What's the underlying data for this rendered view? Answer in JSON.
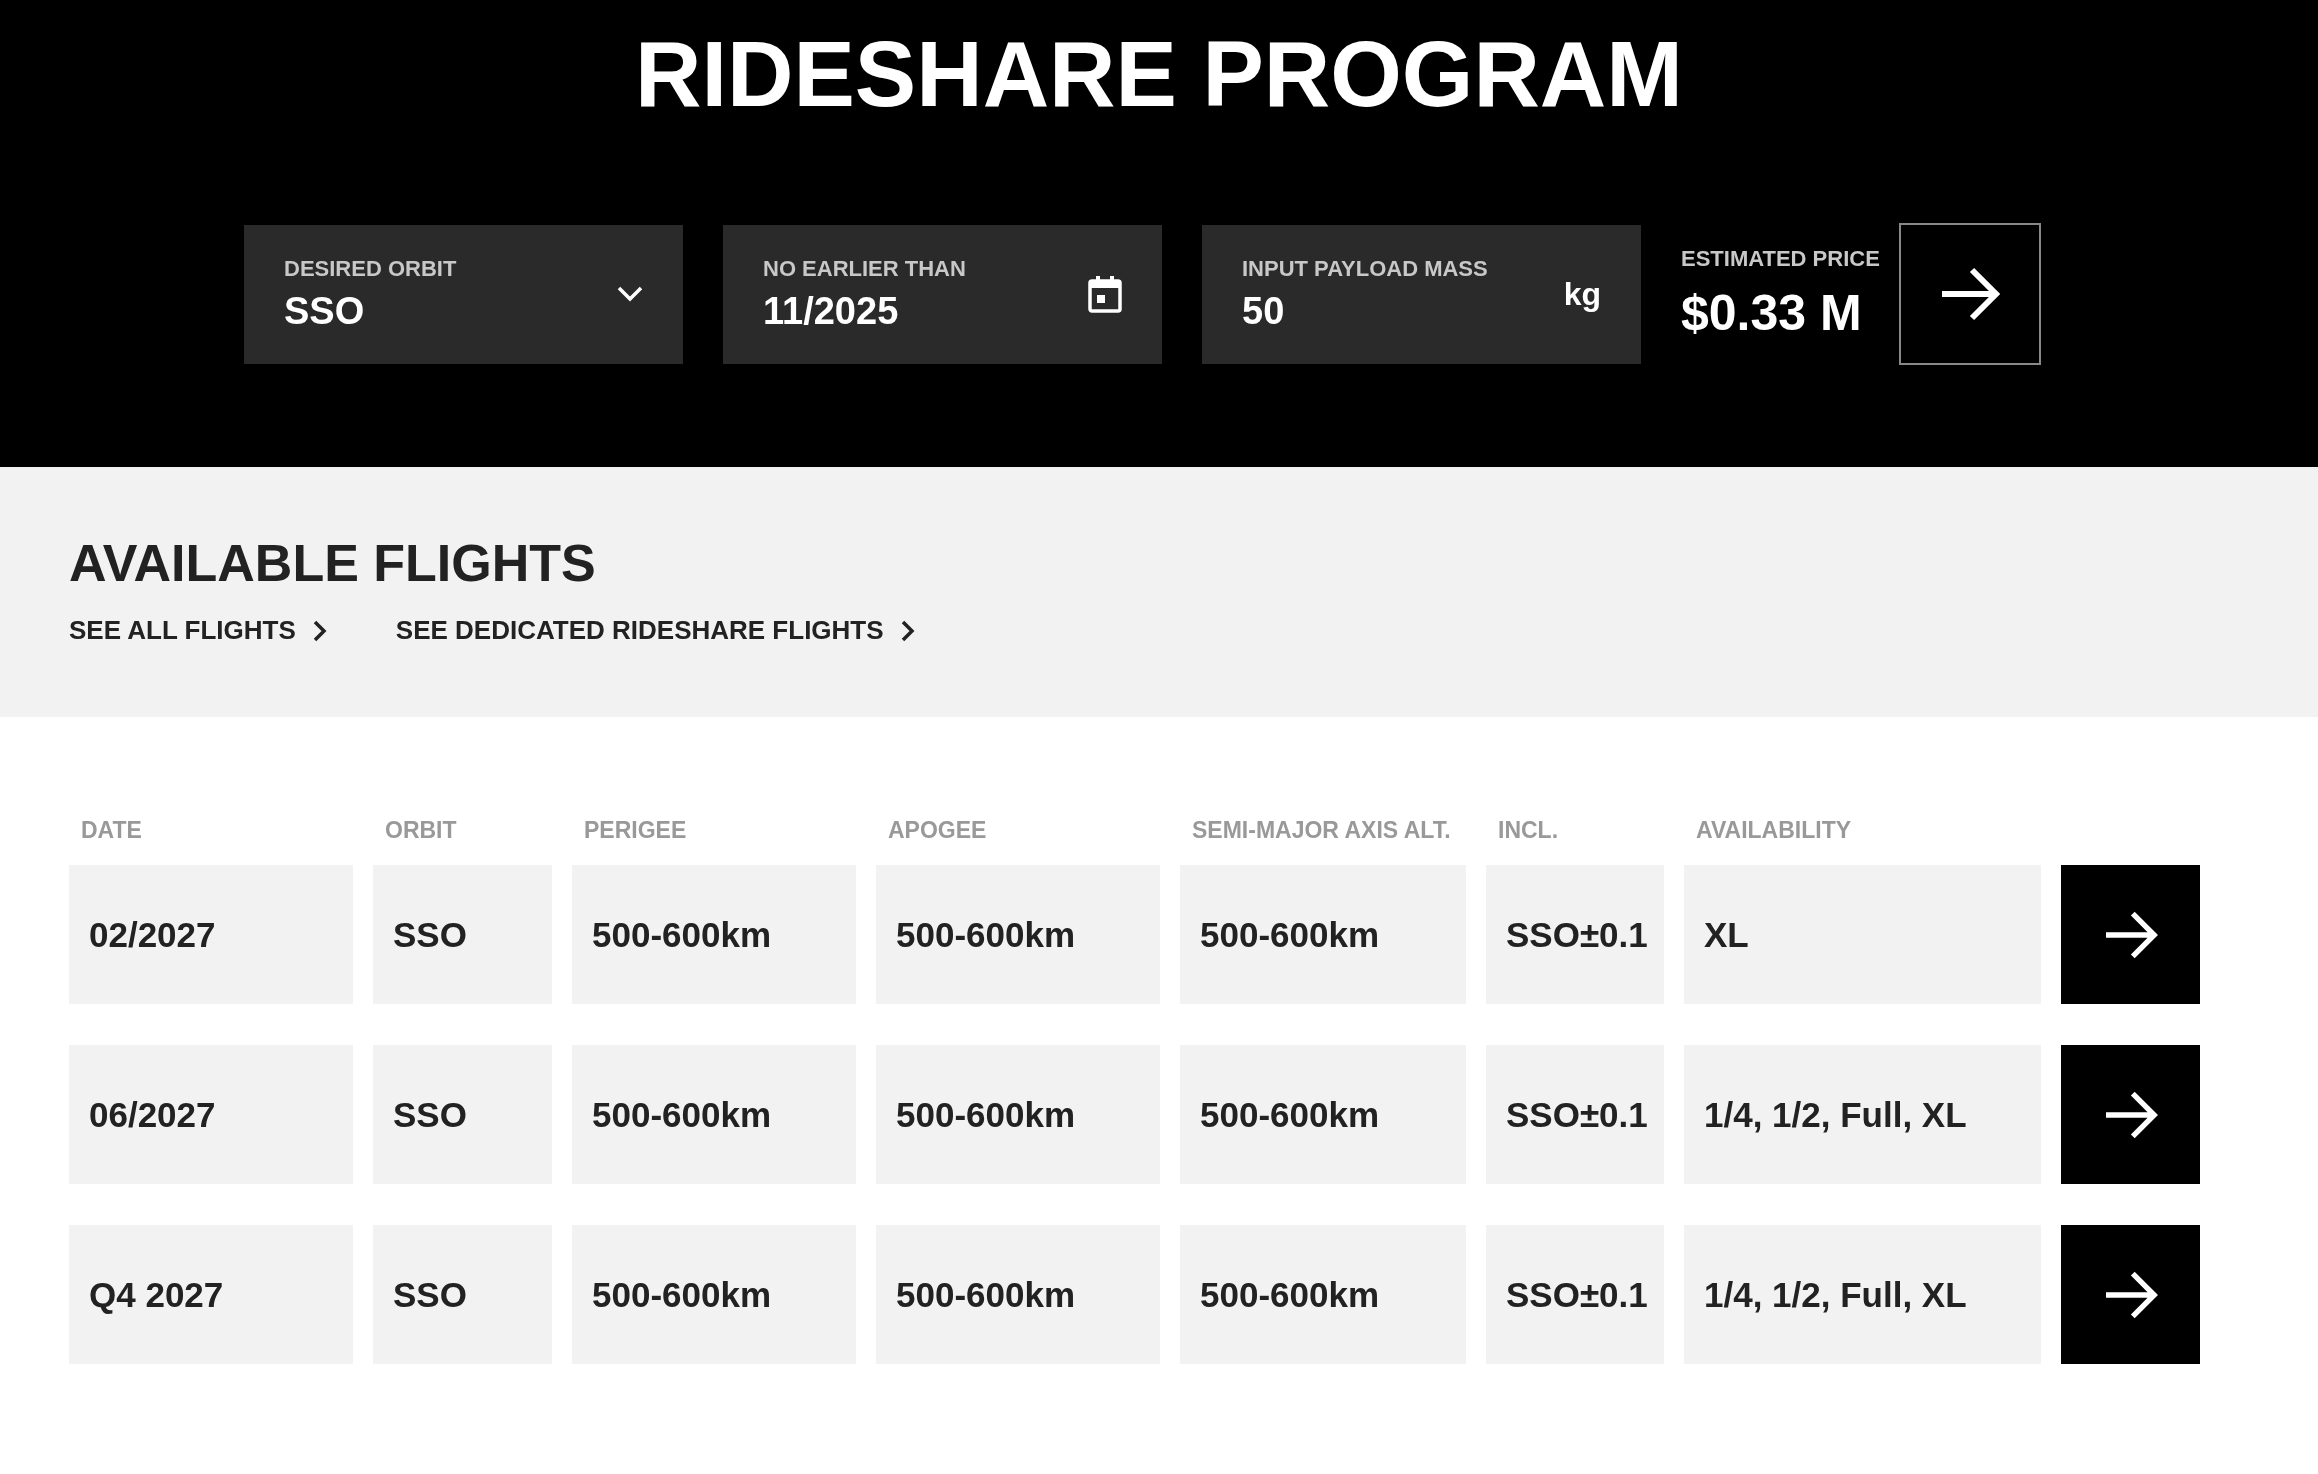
{
  "title": "RIDESHARE PROGRAM",
  "fields": [
    {
      "kind": "dropdown",
      "label": "DESIRED ORBIT",
      "value": "SSO"
    },
    {
      "kind": "date",
      "label": "NO EARLIER THAN",
      "value": "11/2025"
    },
    {
      "kind": "mass",
      "label": "INPUT PAYLOAD MASS",
      "value": "50",
      "unit": "kg"
    }
  ],
  "estimate": {
    "label": "ESTIMATED PRICE",
    "value": "$0.33 M"
  },
  "flights_section": {
    "heading": "AVAILABLE FLIGHTS",
    "links": [
      "SEE ALL FLIGHTS",
      "SEE DEDICATED RIDESHARE FLIGHTS"
    ]
  },
  "table": {
    "columns": [
      "DATE",
      "ORBIT",
      "PERIGEE",
      "APOGEE",
      "SEMI-MAJOR AXIS ALT.",
      "INCL.",
      "AVAILABILITY"
    ],
    "rows": [
      [
        "02/2027",
        "SSO",
        "500-600km",
        "500-600km",
        "500-600km",
        "SSO±0.1",
        "XL"
      ],
      [
        "06/2027",
        "SSO",
        "500-600km",
        "500-600km",
        "500-600km",
        "SSO±0.1",
        "1/4, 1/2, Full, XL"
      ],
      [
        "Q4 2027",
        "SSO",
        "500-600km",
        "500-600km",
        "500-600km",
        "SSO±0.1",
        "1/4, 1/2, Full, XL"
      ]
    ]
  }
}
